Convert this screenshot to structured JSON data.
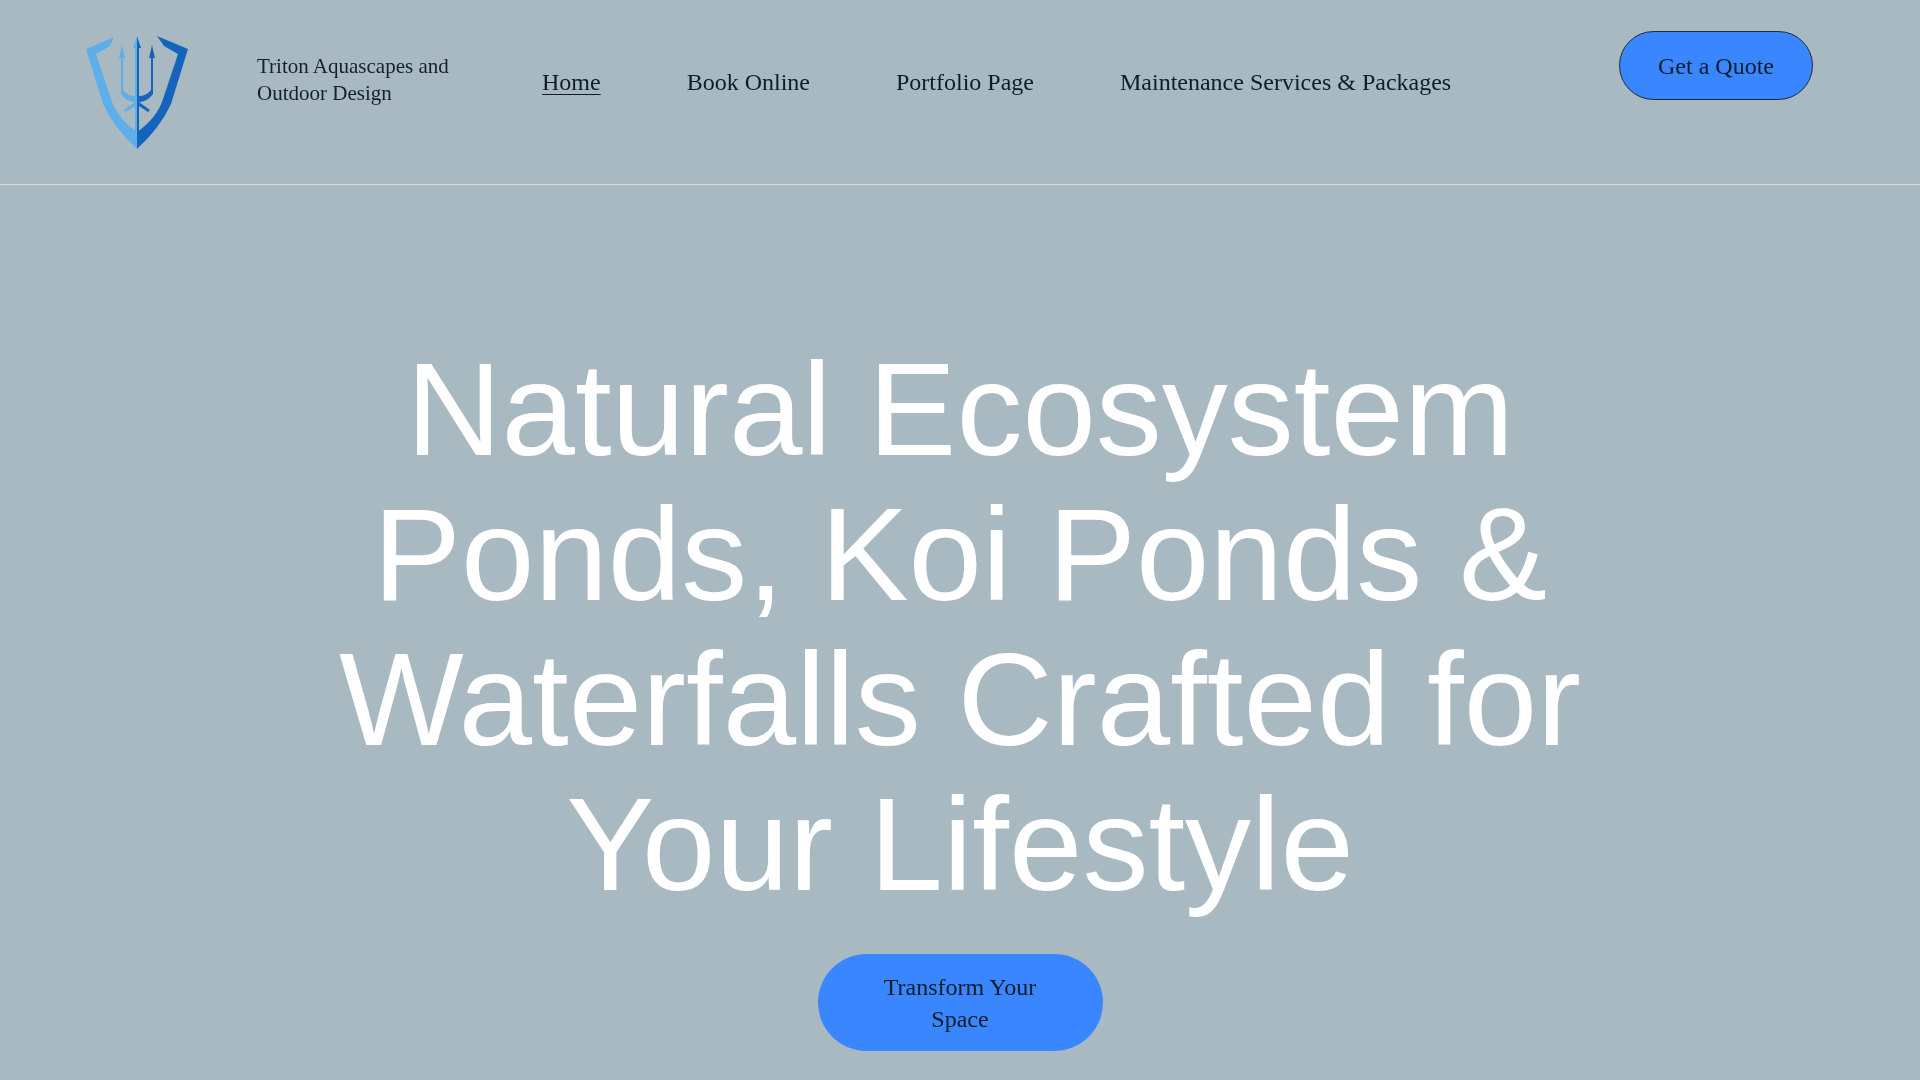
{
  "header": {
    "brand": "Triton Aquascapes and Outdoor Design",
    "nav": [
      {
        "label": "Home",
        "selected": true
      },
      {
        "label": "Book Online",
        "selected": false
      },
      {
        "label": "Portfolio Page",
        "selected": false
      },
      {
        "label": "Maintenance Services & Packages",
        "selected": false
      }
    ],
    "cta": "Get a Quote"
  },
  "hero": {
    "heading": "Natural Ecosystem Ponds, Koi Ponds & Waterfalls Crafted for Your Lifestyle",
    "button": "Transform Your Space"
  }
}
